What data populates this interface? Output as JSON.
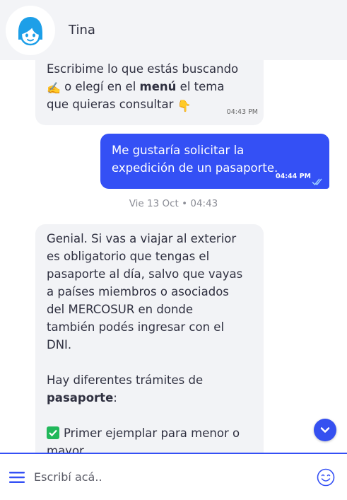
{
  "header": {
    "contact_name": "Tina",
    "avatar_icon": "girl-face-icon"
  },
  "messages": {
    "first": {
      "line1": "Escribime lo que estás buscando",
      "emoji1": "✍️",
      "line2_pre": " o elegí en el ",
      "line2_bold": "menú",
      "line2_post": " el tema",
      "line3": "que quieras consultar ",
      "emoji2": "👇",
      "time": "04:43 PM"
    },
    "outgoing": {
      "line1": "Me gustaría solicitar la",
      "line2": "expedición de un pasaporte.",
      "time": "04:44 PM",
      "status_icon": "double-check-icon"
    },
    "date_separator": "Vie 13 Oct • 04:43",
    "reply": {
      "lines": [
        "Genial. Si vas a viajar al exterior",
        "es obligatorio que tengas el",
        "pasaporte al día, salvo que vayas",
        "a países miembros o asociados",
        "del MERCOSUR en donde",
        "también podés ingresar con el",
        "DNI."
      ],
      "p2_line1": "Hay diferentes trámites de",
      "p2_bold": "pasaporte",
      "p2_colon": ":",
      "item1_line1": "Primer ejemplar para menor o",
      "item1_line2": "mayor"
    }
  },
  "composer": {
    "placeholder": "Escribí acá..",
    "menu_icon": "hamburger-menu-icon",
    "emoji_icon": "smiley-icon"
  },
  "colors": {
    "accent": "#3450f5",
    "header_bg": "#f3f4f7",
    "incoming_bg": "#f2f3f6",
    "check_green": "#21b85b",
    "avatar_blue": "#1d9fe8"
  }
}
